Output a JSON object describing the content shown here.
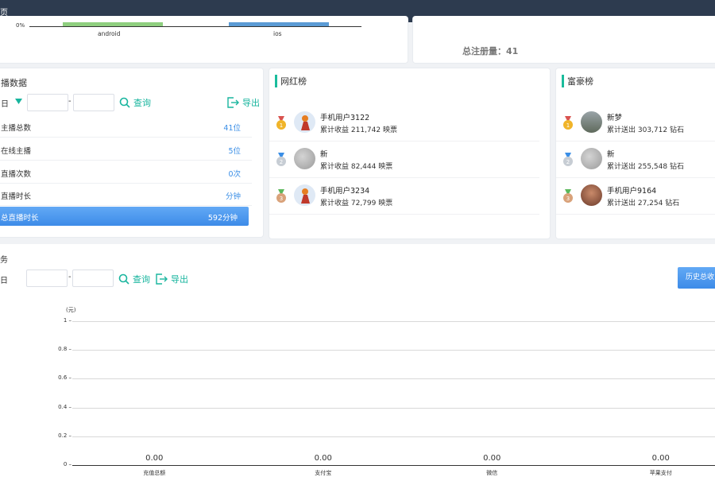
{
  "topbar": {
    "title": "页"
  },
  "top_chart": {
    "y0_label": "0%",
    "categories": [
      "android",
      "ios"
    ],
    "colors": [
      "#8fcf7f",
      "#5b9bd5"
    ]
  },
  "register": {
    "label": "总注册量：41"
  },
  "anchor_panel": {
    "title": "播数据",
    "dropdown_label": "日",
    "date_separator": "-",
    "search_label": "查询",
    "export_label": "导出",
    "rows": [
      {
        "label": "主播总数",
        "value": "41位"
      },
      {
        "label": "在线主播",
        "value": "5位"
      },
      {
        "label": "直播次数",
        "value": "0次"
      },
      {
        "label": "直播时长",
        "value": "分钟"
      },
      {
        "label": "总直播时长",
        "value": "592分钟"
      }
    ]
  },
  "influencer_panel": {
    "title": "网红榜",
    "items": [
      {
        "name": "手机用户3122",
        "sub": "累计收益 211,742 映票",
        "medal": "1"
      },
      {
        "name": "新",
        "sub": "累计收益 82,444 映票",
        "medal": "2"
      },
      {
        "name": "手机用户3234",
        "sub": "累计收益 72,799 映票",
        "medal": "3"
      }
    ]
  },
  "rich_panel": {
    "title": "富豪榜",
    "items": [
      {
        "name": "新梦",
        "sub": "累计送出 303,712 钻石",
        "medal": "1"
      },
      {
        "name": "新",
        "sub": "累计送出 255,548 钻石",
        "medal": "2"
      },
      {
        "name": "手机用户9164",
        "sub": "累计送出 27,254 钻石",
        "medal": "3"
      }
    ]
  },
  "finance_panel": {
    "title": "务",
    "dropdown_label": "日",
    "date_separator": "-",
    "search_label": "查询",
    "export_label": "导出",
    "history_button": "历史总收"
  },
  "chart_data": {
    "type": "bar",
    "ylabel": "(元)",
    "ylim": [
      0,
      1
    ],
    "yticks": [
      "0",
      "0.2",
      "0.4",
      "0.6",
      "0.8",
      "1"
    ],
    "categories": [
      "充值总额",
      "支付宝",
      "微信",
      "苹果支付"
    ],
    "values": [
      0,
      0,
      0,
      0
    ],
    "value_labels": [
      "0.00",
      "0.00",
      "0.00",
      "0.00"
    ],
    "grid": true
  }
}
